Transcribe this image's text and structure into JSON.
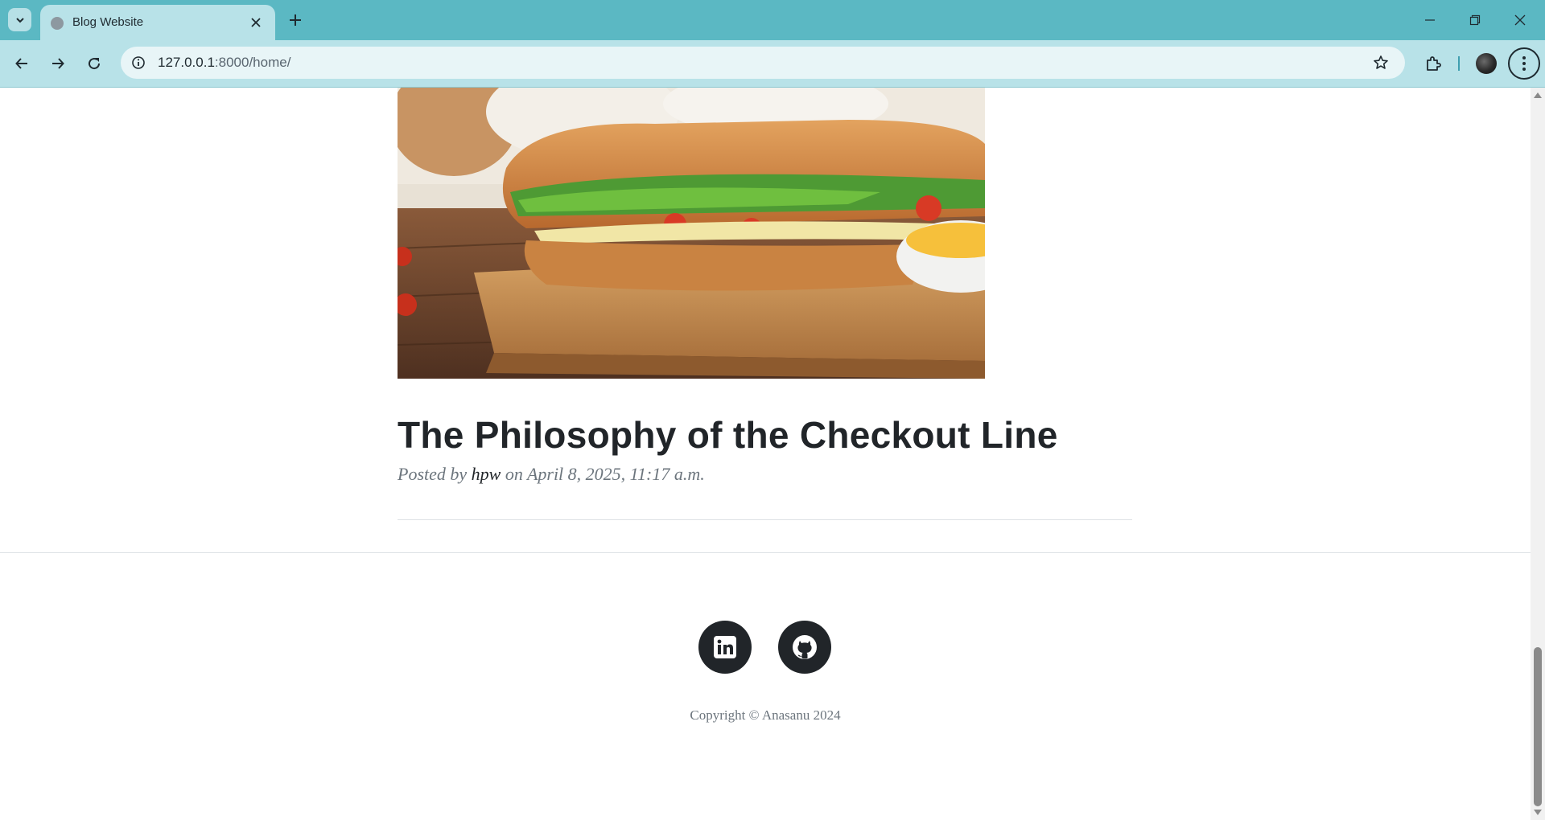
{
  "browser": {
    "tab_title": "Blog Website",
    "url_host": "127.0.0.1",
    "url_rest": ":8000/home/"
  },
  "post": {
    "title": "The Philosophy of the Checkout Line",
    "meta_prefix": "Posted by",
    "author": "hpw",
    "meta_suffix": "on April 8, 2025, 11:17 a.m."
  },
  "footer": {
    "copyright": "Copyright © Anasanu 2024",
    "social_icons": [
      "linkedin-icon",
      "github-icon"
    ]
  },
  "colors": {
    "tabbar": "#5bb8c3",
    "toolbar": "#b8e2e8",
    "text_dark": "#212529",
    "text_muted": "#6c757d"
  },
  "scroll": {
    "position_fraction": 1.0
  }
}
